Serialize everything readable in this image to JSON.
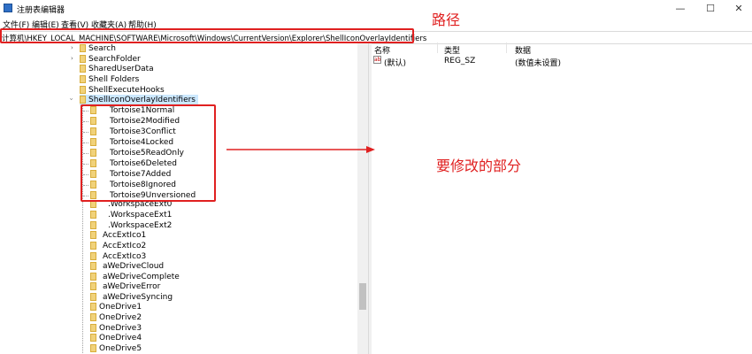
{
  "window": {
    "title": "注册表编辑器",
    "controls": [
      "—",
      "☐",
      "✕"
    ]
  },
  "menu": [
    "文件(F)",
    "编辑(E)",
    "查看(V)",
    "收藏夹(A)",
    "帮助(H)"
  ],
  "address": "计算机\\HKEY_LOCAL_MACHINE\\SOFTWARE\\Microsoft\\Windows\\CurrentVersion\\Explorer\\ShellIconOverlayIdentifiers",
  "tree": {
    "top_items": [
      "Search",
      "SearchFolder",
      "SharedUserData",
      "Shell Folders",
      "ShellExecuteHooks"
    ],
    "selected": "ShellIconOverlayIdentifiers",
    "tortoise_items": [
      "Tortoise1Normal",
      "Tortoise2Modified",
      "Tortoise3Conflict",
      "Tortoise4Locked",
      "Tortoise5ReadOnly",
      "Tortoise6Deleted",
      "Tortoise7Added",
      "Tortoise8Ignored",
      "Tortoise9Unversioned"
    ],
    "other_items": [
      ".WorkspaceExt0",
      ".WorkspaceExt1",
      ".WorkspaceExt2",
      "AccExtIco1",
      "AccExtIco2",
      "AccExtIco3",
      "aWeDriveCloud",
      "aWeDriveComplete",
      "aWeDriveError",
      "aWeDriveSyncing",
      "OneDrive1",
      "OneDrive2",
      "OneDrive3",
      "OneDrive4",
      "OneDrive5"
    ]
  },
  "values": {
    "headers": [
      "名称",
      "类型",
      "数据"
    ],
    "rows": [
      {
        "name": "(默认)",
        "type": "REG_SZ",
        "data": "(数值未设置)"
      }
    ]
  },
  "annotations": {
    "path_label": "路径",
    "modify_label": "要修改的部分",
    "color": "#e02020"
  }
}
